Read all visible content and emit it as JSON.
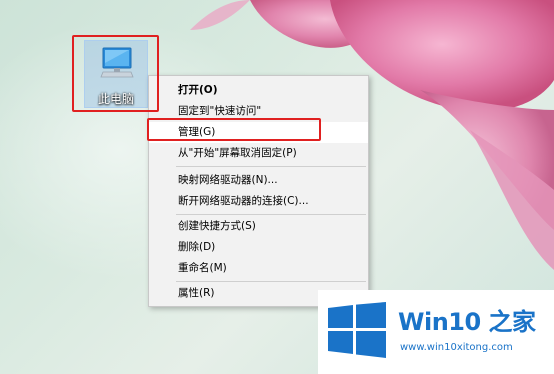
{
  "desktop": {
    "icon_label": "此电脑"
  },
  "context_menu": {
    "items": [
      {
        "label": "打开(O)"
      },
      {
        "label": "固定到\"快速访问\""
      },
      {
        "label": "管理(G)"
      },
      {
        "label": "从\"开始\"屏幕取消固定(P)"
      },
      {
        "label": "映射网络驱动器(N)..."
      },
      {
        "label": "断开网络驱动器的连接(C)..."
      },
      {
        "label": "创建快捷方式(S)"
      },
      {
        "label": "删除(D)"
      },
      {
        "label": "重命名(M)"
      },
      {
        "label": "属性(R)"
      }
    ]
  },
  "watermark": {
    "title": "Win10 之家",
    "url": "www.win10xitong.com",
    "brand_color": "#1a73c8"
  },
  "colors": {
    "highlight": "#e02020",
    "menu_bg": "#f2f2f2"
  }
}
